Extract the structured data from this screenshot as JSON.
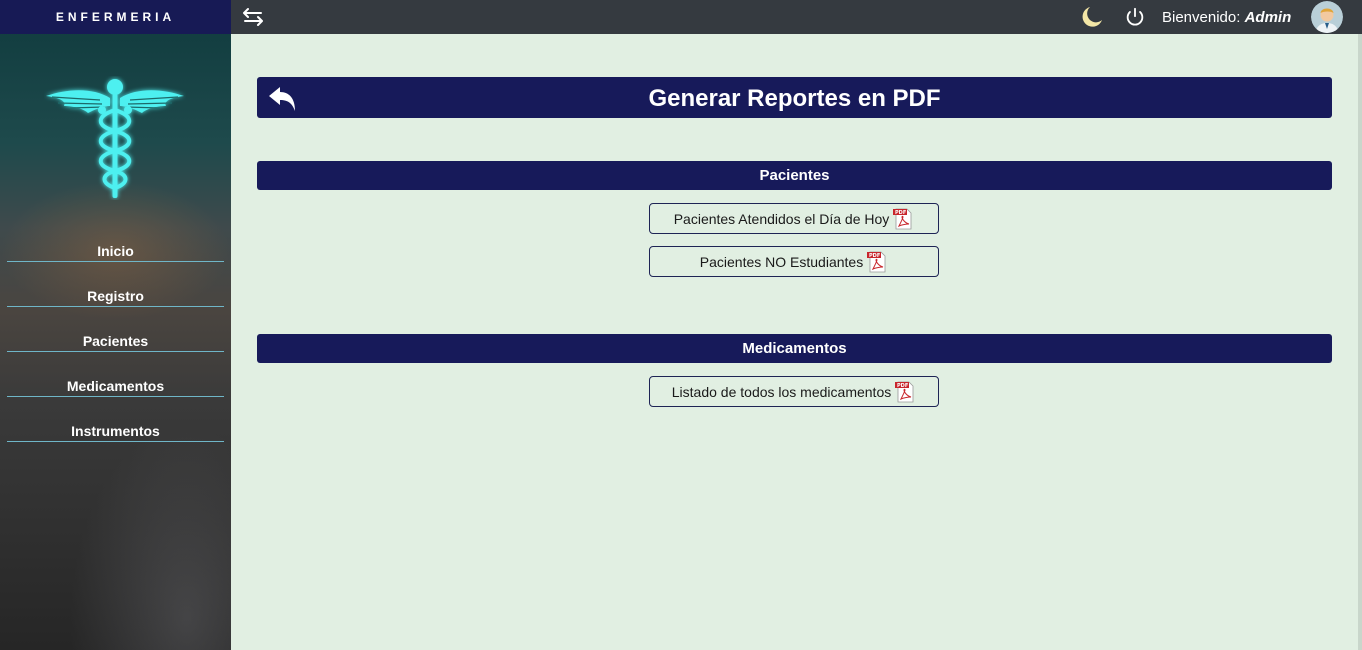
{
  "sidebar": {
    "brand": "ENFERMERIA",
    "items": [
      {
        "label": "Inicio"
      },
      {
        "label": "Registro"
      },
      {
        "label": "Pacientes"
      },
      {
        "label": "Medicamentos"
      },
      {
        "label": "Instrumentos"
      }
    ]
  },
  "topbar": {
    "welcome_prefix": "Bienvenido:",
    "user": "Admin"
  },
  "page": {
    "title": "Generar Reportes en PDF",
    "sections": [
      {
        "title": "Pacientes",
        "reports": [
          {
            "label": "Pacientes Atendidos el Día de Hoy"
          },
          {
            "label": "Pacientes NO Estudiantes"
          }
        ]
      },
      {
        "title": "Medicamentos",
        "reports": [
          {
            "label": "Listado de todos los medicamentos"
          }
        ]
      }
    ]
  },
  "colors": {
    "navy": "#171a5a",
    "background": "#e1efe2",
    "topbar": "#353a40",
    "logo": "#4ef0f0",
    "moon": "#f3e6a6"
  },
  "icons": [
    "toggle-arrows-icon",
    "moon-icon",
    "power-icon",
    "avatar",
    "back-arrow-icon",
    "pdf-icon",
    "caduceus-logo"
  ]
}
